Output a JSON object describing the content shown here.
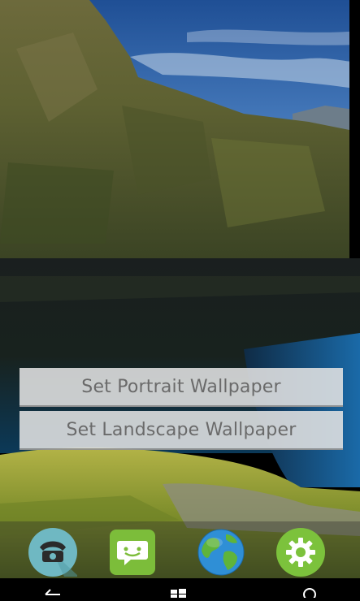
{
  "buttons": {
    "portrait_label": "Set Portrait Wallpaper",
    "landscape_label": "Set Landscape Wallpaper"
  },
  "dock": {
    "apps": [
      {
        "icon": "phone-icon",
        "color": "#6fb8c2"
      },
      {
        "icon": "message-icon",
        "color": "#7cbd3a"
      },
      {
        "icon": "globe-icon",
        "color": "#2f8fd6"
      },
      {
        "icon": "settings-icon",
        "color": "#7cc23c"
      }
    ]
  },
  "navbar": {
    "icons": [
      "back-icon",
      "windows-home-icon",
      "search-icon"
    ]
  }
}
